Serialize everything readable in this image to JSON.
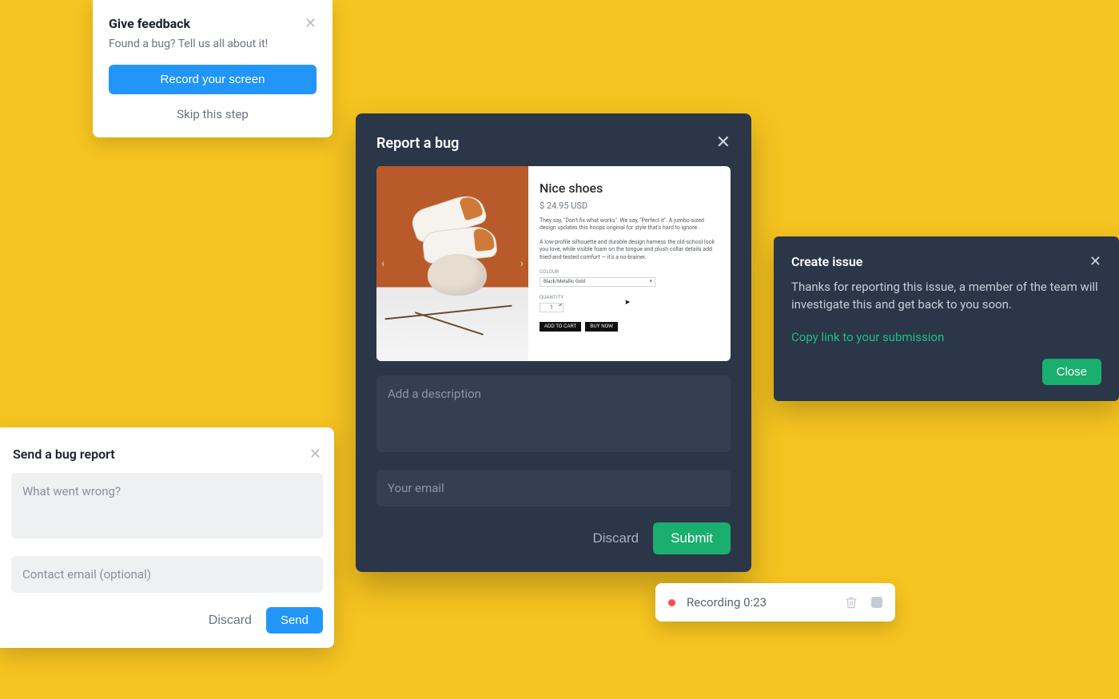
{
  "feedback": {
    "title": "Give feedback",
    "subtitle": "Found a bug? Tell us all about it!",
    "record_label": "Record your screen",
    "skip_label": "Skip this step"
  },
  "bug_report": {
    "title": "Send a bug report",
    "desc_placeholder": "What went wrong?",
    "email_placeholder": "Contact email (optional)",
    "discard_label": "Discard",
    "send_label": "Send"
  },
  "report_modal": {
    "title": "Report a bug",
    "desc_placeholder": "Add a description",
    "email_placeholder": "Your email",
    "discard_label": "Discard",
    "submit_label": "Submit",
    "screenshot": {
      "product_title": "Nice shoes",
      "price": "$ 24.95 USD",
      "para1": "They say, \"Don't fix what works\". We say, \"Perfect it\". A jumbo-sized design updates this hoops original for style that's hard to ignore.",
      "para2": "A low-profile silhouette and durable design harness the old-school look you love, while visible foam on the tongue and plush collar details add tried-and-tested comfort — it's a no-brainer.",
      "colour_label": "COLOUR",
      "colour_value": "Black/Metallic Gold",
      "quantity_label": "QUANTITY",
      "quantity_value": "1",
      "add_to_cart": "ADD TO CART",
      "buy_now": "BUY NOW"
    }
  },
  "create_issue": {
    "title": "Create issue",
    "body": "Thanks for reporting this issue, a member of the team will investigate this and get back to you soon.",
    "copy_link_label": "Copy link to your submission",
    "close_label": "Close"
  },
  "recording": {
    "label": "Recording 0:23"
  }
}
